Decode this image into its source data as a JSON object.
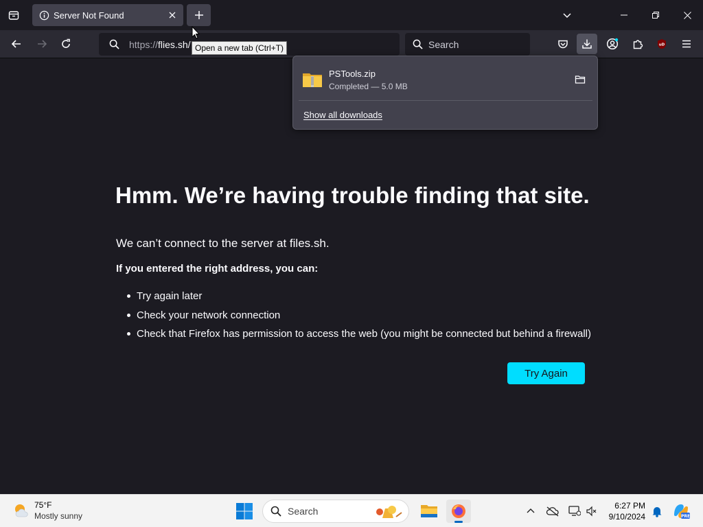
{
  "tab": {
    "title": "Server Not Found"
  },
  "tooltip": {
    "text": "Open a new tab (Ctrl+T)"
  },
  "urlbar": {
    "scheme": "https://",
    "host": "flies.sh/"
  },
  "searchbar": {
    "placeholder": "Search"
  },
  "downloads_panel": {
    "item": {
      "filename": "PSTools.zip",
      "status": "Completed — 5.0 MB"
    },
    "show_all_label": "Show all downloads"
  },
  "error": {
    "title": "Hmm. We’re having trouble finding that site.",
    "description": "We can’t connect to the server at files.sh.",
    "subtitle": "If you entered the right address, you can:",
    "suggestions": [
      "Try again later",
      "Check your network connection",
      "Check that Firefox has permission to access the web (you might be connected but behind a firewall)"
    ],
    "try_again_label": "Try Again"
  },
  "taskbar": {
    "weather": {
      "temp": "75°F",
      "condition": "Mostly sunny"
    },
    "search_label": "Search",
    "clock": {
      "time": "6:27 PM",
      "date": "9/10/2024"
    }
  },
  "colors": {
    "accent": "#00ddff",
    "page_bg": "#1c1b22",
    "toolbar_bg": "#2b2a33",
    "panel_bg": "#42414d"
  }
}
